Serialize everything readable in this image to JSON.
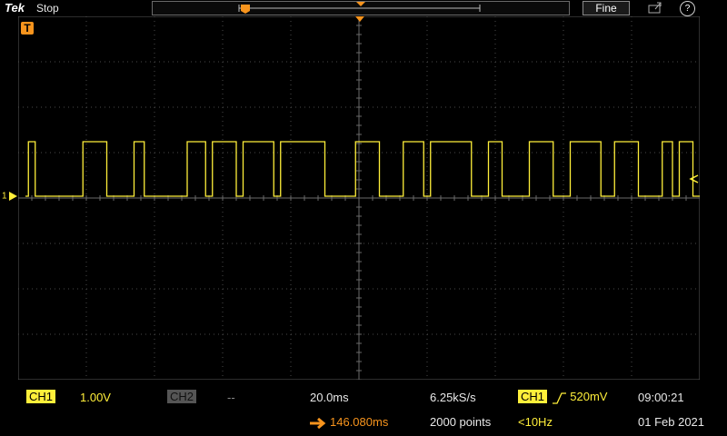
{
  "header": {
    "brand": "Tek",
    "run_state": "Stop",
    "fine_label": "Fine",
    "help_label": "?"
  },
  "markers": {
    "trigger_label": "T",
    "ch1_label": "1"
  },
  "channel1": {
    "badge": "CH1",
    "scale": "1.00V",
    "color": "#ffef3a"
  },
  "channel2": {
    "badge": "CH2",
    "scale": "--"
  },
  "timebase": {
    "scale": "20.0ms",
    "position": "146.080ms",
    "sample_rate": "6.25kS/s",
    "record_length": "2000 points"
  },
  "trigger": {
    "source": "CH1",
    "slope_icon": "rising-edge-icon",
    "level": "520mV",
    "frequency": "<10Hz",
    "color": "#f7941d"
  },
  "clock": {
    "time": "09:00:21",
    "date": "01 Feb 2021"
  },
  "waveform": {
    "high_level_div": 1.0,
    "low_level_div": 0.0,
    "edges_div": [
      0.15,
      0.25,
      0.95,
      1.3,
      1.7,
      1.85,
      2.48,
      2.75,
      2.85,
      3.2,
      3.3,
      3.75,
      3.85,
      4.5,
      4.95,
      5.3,
      5.65,
      5.95,
      6.05,
      6.65,
      6.9,
      7.1,
      7.5,
      7.85,
      8.1,
      8.55,
      8.75,
      9.1,
      9.45,
      9.6,
      9.7,
      9.9
    ],
    "start_state": "low",
    "end_x_div": 10.0
  }
}
